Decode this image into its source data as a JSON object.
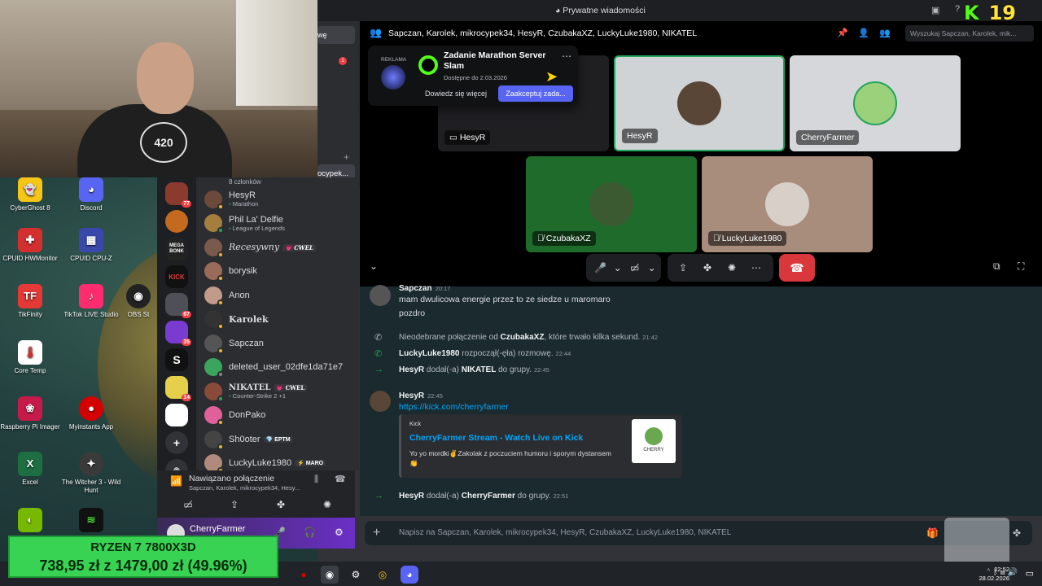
{
  "titlebar": {
    "title": "Prywatne wiadomości"
  },
  "stream_overlay": {
    "kick": "K",
    "count": "19"
  },
  "webcam": {
    "shirt_text": "420"
  },
  "desktop_icons": [
    {
      "label": "CyberGhost 8",
      "icon": "cyberghost-icon",
      "color": "#f5c518"
    },
    {
      "label": "Discord",
      "icon": "discord-icon",
      "color": "#5865f2"
    },
    {
      "label": "CPUID HWMonitor",
      "icon": "hwmonitor-icon",
      "color": "#d32f2f"
    },
    {
      "label": "CPUID CPU-Z",
      "icon": "cpuz-icon",
      "color": "#3949ab"
    },
    {
      "label": "TikFinity",
      "icon": "tikfinity-icon",
      "color": "#e53935"
    },
    {
      "label": "TikTok LIVE Studio",
      "icon": "tiktok-icon",
      "color": "#ff2d6f"
    },
    {
      "label": "OBS St",
      "icon": "obs-icon",
      "color": "#222222"
    },
    {
      "label": "Core Temp",
      "icon": "thermometer-icon",
      "color": "#ffffff"
    },
    {
      "label": "Raspberry Pi Imager",
      "icon": "raspberry-icon",
      "color": "#c51a4a"
    },
    {
      "label": "Myinstants App",
      "icon": "red-button-icon",
      "color": "#d50000"
    },
    {
      "label": "Excel",
      "icon": "excel-icon",
      "color": "#1d6f42"
    },
    {
      "label": "The Witcher 3 - Wild Hunt",
      "icon": "witcher-icon",
      "color": "#3a3a3a"
    }
  ],
  "server_rail": [
    {
      "icon": "server-avatar-icon",
      "badge": "77",
      "color": "#8a3b2e"
    },
    {
      "icon": "server-orange-icon",
      "badge": "",
      "color": "#c46a1f"
    },
    {
      "icon": "megabonk-icon",
      "badge": "",
      "color": "#222222",
      "text": "MEGA BONK"
    },
    {
      "icon": "kick-server-icon",
      "badge": "",
      "color": "#111111",
      "text": "KICK"
    },
    {
      "icon": "folder-icon",
      "badge": "67",
      "color": "#4e5058"
    },
    {
      "icon": "server-purple-icon",
      "badge": "35",
      "color": "#7a3bd1"
    },
    {
      "icon": "s-server-icon",
      "badge": "",
      "color": "#111111",
      "text": "S"
    },
    {
      "icon": "server-yellow-icon",
      "badge": "14",
      "color": "#e4d04a"
    },
    {
      "icon": "cherry-server-icon",
      "badge": "",
      "color": "#ffffff"
    },
    {
      "icon": "add-server-icon",
      "badge": "",
      "color": "#313338",
      "text": "+"
    },
    {
      "icon": "discover-icon",
      "badge": "",
      "color": "#313338",
      "text": "⌾"
    }
  ],
  "members": {
    "count_label": "8 członków",
    "list": [
      {
        "name": "HesyR",
        "sub": "Marathon",
        "tag": "",
        "avatar_color": "#6b4a3a",
        "status": "#f0b232"
      },
      {
        "name": "Phil La' Delfie",
        "sub": "League of Legends",
        "tag": "",
        "avatar_color": "#a57d3c",
        "status": "#23a55a"
      },
      {
        "name": "Recesywny",
        "sub": "",
        "tag": "💗 CWEL",
        "avatar_color": "#7a5a4a",
        "status": "#f0b232"
      },
      {
        "name": "borysik",
        "sub": "",
        "tag": "",
        "avatar_color": "#9b6b5a",
        "status": "#f0b232"
      },
      {
        "name": "Anon",
        "sub": "",
        "tag": "",
        "avatar_color": "#c19a8a",
        "status": "#f0b232"
      },
      {
        "name": "Karolek",
        "sub": "",
        "tag": "",
        "avatar_color": "#333333",
        "status": "#f0b232"
      },
      {
        "name": "Sapczan",
        "sub": "",
        "tag": "",
        "avatar_color": "#555555",
        "status": "#f0b232"
      },
      {
        "name": "deleted_user_02dfe1da71e7",
        "sub": "",
        "tag": "",
        "avatar_color": "#3ba55d",
        "status": "#80848e"
      },
      {
        "name": "NIKATEL",
        "sub": "Counter-Strike 2 +1",
        "tag": "💗 CWEL",
        "avatar_color": "#8a4a3a",
        "status": "#23a55a"
      },
      {
        "name": "DonPako",
        "sub": "",
        "tag": "",
        "avatar_color": "#e0609a",
        "status": "#f0b232"
      },
      {
        "name": "Sh0oter",
        "sub": "",
        "tag": "💎 EPTM",
        "avatar_color": "#444444",
        "status": "#f0b232"
      },
      {
        "name": "LuckyLuke1980",
        "sub": "",
        "tag": "⚡ MARO",
        "avatar_color": "#b08a7a",
        "status": "#f0b232"
      }
    ]
  },
  "voice_panel": {
    "title": "Nawiązano połączenie",
    "subtitle": "Sapczan, Karolek, mikrocypek34, Hesy..."
  },
  "user_panel": {
    "username": "CherryFarmer"
  },
  "dm_strip": {
    "friends_label": "wę",
    "badge": "1",
    "active_dm_label": "ocypek..."
  },
  "call_header": {
    "title": "Sapczan, Karolek, mikrocypek34, HesyR, CzubakaXZ, LuckyLuke1980, NIKATEL",
    "search_placeholder": "Wyszukaj Sapczan, Karolek, mik..."
  },
  "ad": {
    "label": "REKLAMA",
    "title": "Zadanie Marathon Server Slam",
    "date": "Dostępne do 2.03.2026",
    "learn_more": "Dowiedz się więcej",
    "accept": "Zaakceptuj zada..."
  },
  "tiles": [
    {
      "name": "HesyR",
      "bg": "#1f1f22",
      "avatar_color": "#1f1f22",
      "icon": "screen-share-icon"
    },
    {
      "name": "HesyR",
      "bg": "#cfd3d6",
      "avatar_color": "#5a4636",
      "icon": ""
    },
    {
      "name": "CherryFarmer",
      "bg": "#d5d7da",
      "avatar_color": "#9ad17a",
      "icon": ""
    },
    {
      "name": "CzubakaXZ",
      "bg": "#1e6b2c",
      "avatar_color": "#3c5a32",
      "icon": "muted-icon"
    },
    {
      "name": "LuckyLuke1980",
      "bg": "#a98d7c",
      "avatar_color": "#d8d0c8",
      "icon": "muted-icon"
    }
  ],
  "chat": {
    "msg1": {
      "author": "Sapczan",
      "time": "20:17",
      "lines": [
        "mam dwulicowa energie przez to ze siedze u maromaro",
        "pozdro"
      ]
    },
    "sys1": {
      "pre": "Nieodebrane połączenie od",
      "who": "CzubakaXZ",
      "post": ", które trwało kilka sekund.",
      "time": "21:42"
    },
    "sys2": {
      "who": "LuckyLuke1980",
      "post": "rozpoczął(-ęła) rozmowę.",
      "time": "22:44"
    },
    "sys3": {
      "who": "HesyR",
      "mid": "dodał(-a)",
      "target": "NIKATEL",
      "post": "do grupy.",
      "time": "22:45"
    },
    "msg2": {
      "author": "HesyR",
      "time": "22:45",
      "link": "https://kick.com/cherryfarmer"
    },
    "embed": {
      "provider": "Kick",
      "title": "CherryFarmer Stream - Watch Live on Kick",
      "description": "Yo yo mordki✌️Zakolak z poczuciem humoru i sporym dystansem 👏",
      "thumb_text": "CHERRY"
    },
    "sys4": {
      "who": "HesyR",
      "mid": "dodał(-a)",
      "target": "CherryFarmer",
      "post": "do grupy.",
      "time": "22:51"
    }
  },
  "composer": {
    "placeholder": "Napisz na Sapczan, Karolek, mikrocypek34, HesyR, CzubakaXZ, LuckyLuke1980, NIKATEL"
  },
  "taskbar": {
    "clock_time": "22:52",
    "clock_date": "28.02.2026"
  },
  "price_overlay": {
    "product": "RYZEN 7 7800X3D",
    "price": "738,95 zł z 1479,00 zł (49.96%)"
  }
}
